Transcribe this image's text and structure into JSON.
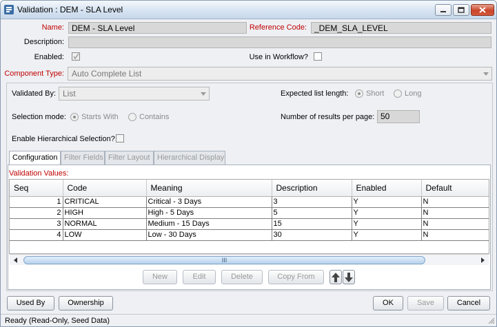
{
  "window": {
    "title": "Validation : DEM - SLA Level",
    "controls": {
      "minimize": "minimize",
      "maximize": "maximize",
      "close": "close"
    }
  },
  "form": {
    "name_label": "Name:",
    "name_value": "DEM - SLA Level",
    "refcode_label": "Reference Code:",
    "refcode_value": "_DEM_SLA_LEVEL",
    "description_label": "Description:",
    "description_value": "",
    "enabled_label": "Enabled:",
    "enabled_checked": true,
    "workflow_label": "Use in Workflow?",
    "workflow_checked": false,
    "component_type_label": "Component Type:",
    "component_type_value": "Auto Complete List",
    "validated_by_label": "Validated By:",
    "validated_by_value": "List",
    "list_length_label": "Expected list length:",
    "list_length_options": [
      "Short",
      "Long"
    ],
    "list_length_selected": "Short",
    "selection_mode_label": "Selection mode:",
    "selection_mode_options": [
      "Starts With",
      "Contains"
    ],
    "selection_mode_selected": "Starts With",
    "results_per_page_label": "Number of results per page:",
    "results_per_page_value": "50",
    "hierarchical_label": "Enable Hierarchical Selection?",
    "hierarchical_checked": false
  },
  "tabs": [
    {
      "label": "Configuration",
      "active": true
    },
    {
      "label": "Filter Fields",
      "active": false
    },
    {
      "label": "Filter Layout",
      "active": false
    },
    {
      "label": "Hierarchical Display",
      "active": false
    }
  ],
  "validation_values": {
    "label": "Validation Values:",
    "columns": [
      "Seq",
      "Code",
      "Meaning",
      "Description",
      "Enabled",
      "Default"
    ],
    "rows": [
      [
        "1",
        "CRITICAL",
        "Critical - 3 Days",
        "3",
        "Y",
        "N"
      ],
      [
        "2",
        "HIGH",
        "High - 5 Days",
        "5",
        "Y",
        "N"
      ],
      [
        "3",
        "NORMAL",
        "Medium - 15 Days",
        "15",
        "Y",
        "N"
      ],
      [
        "4",
        "LOW",
        "Low - 30 Days",
        "30",
        "Y",
        "N"
      ]
    ],
    "scroll_thumb_grip": "III"
  },
  "grid_buttons": {
    "new": "New",
    "edit": "Edit",
    "delete": "Delete",
    "copy_from": "Copy From"
  },
  "footer_buttons": {
    "used_by": "Used By",
    "ownership": "Ownership",
    "ok": "OK",
    "save": "Save",
    "cancel": "Cancel"
  },
  "status": "Ready (Read-Only, Seed Data)",
  "colors": {
    "required_label": "#c00000",
    "accent": "#3a6ea5"
  }
}
